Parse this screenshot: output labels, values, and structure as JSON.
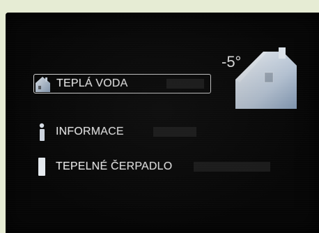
{
  "outdoor": {
    "temperature": "-5°"
  },
  "menu": {
    "items": [
      {
        "label": "TEPLÁ VODA",
        "icon": "house-icon",
        "selected": true
      },
      {
        "label": "INFORMACE",
        "icon": "info-icon",
        "selected": false
      },
      {
        "label": "TEPELNÉ ČERPADLO",
        "icon": "heat-pump-icon",
        "selected": false
      }
    ]
  },
  "colors": {
    "background": "#e6ecd4",
    "screen": "#070707",
    "text": "#f2f2f2",
    "icon": "#b9c6d6",
    "selection_border": "#d9d9d9"
  }
}
